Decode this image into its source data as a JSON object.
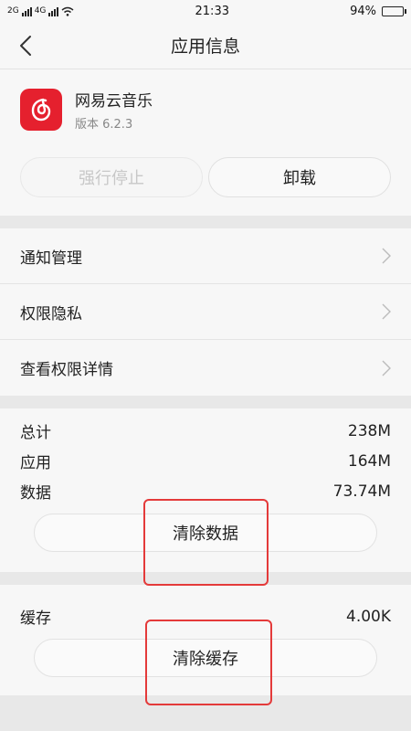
{
  "status_bar": {
    "network_left": "2G",
    "network_right": "4G",
    "time": "21:33",
    "battery_percent": "94%",
    "battery_level": 0.94
  },
  "header": {
    "title": "应用信息"
  },
  "app": {
    "name": "网易云音乐",
    "version": "版本 6.2.3",
    "icon_color": "#e5202e"
  },
  "actions": {
    "force_stop": "强行停止",
    "uninstall": "卸载"
  },
  "settings": [
    {
      "label": "通知管理"
    },
    {
      "label": "权限隐私"
    },
    {
      "label": "查看权限详情"
    }
  ],
  "storage": {
    "total_label": "总计",
    "total_value": "238M",
    "app_label": "应用",
    "app_value": "164M",
    "data_label": "数据",
    "data_value": "73.74M",
    "clear_data": "清除数据"
  },
  "cache": {
    "label": "缓存",
    "value": "4.00K",
    "clear_cache": "清除缓存"
  },
  "highlight_color": "#e43a3a"
}
